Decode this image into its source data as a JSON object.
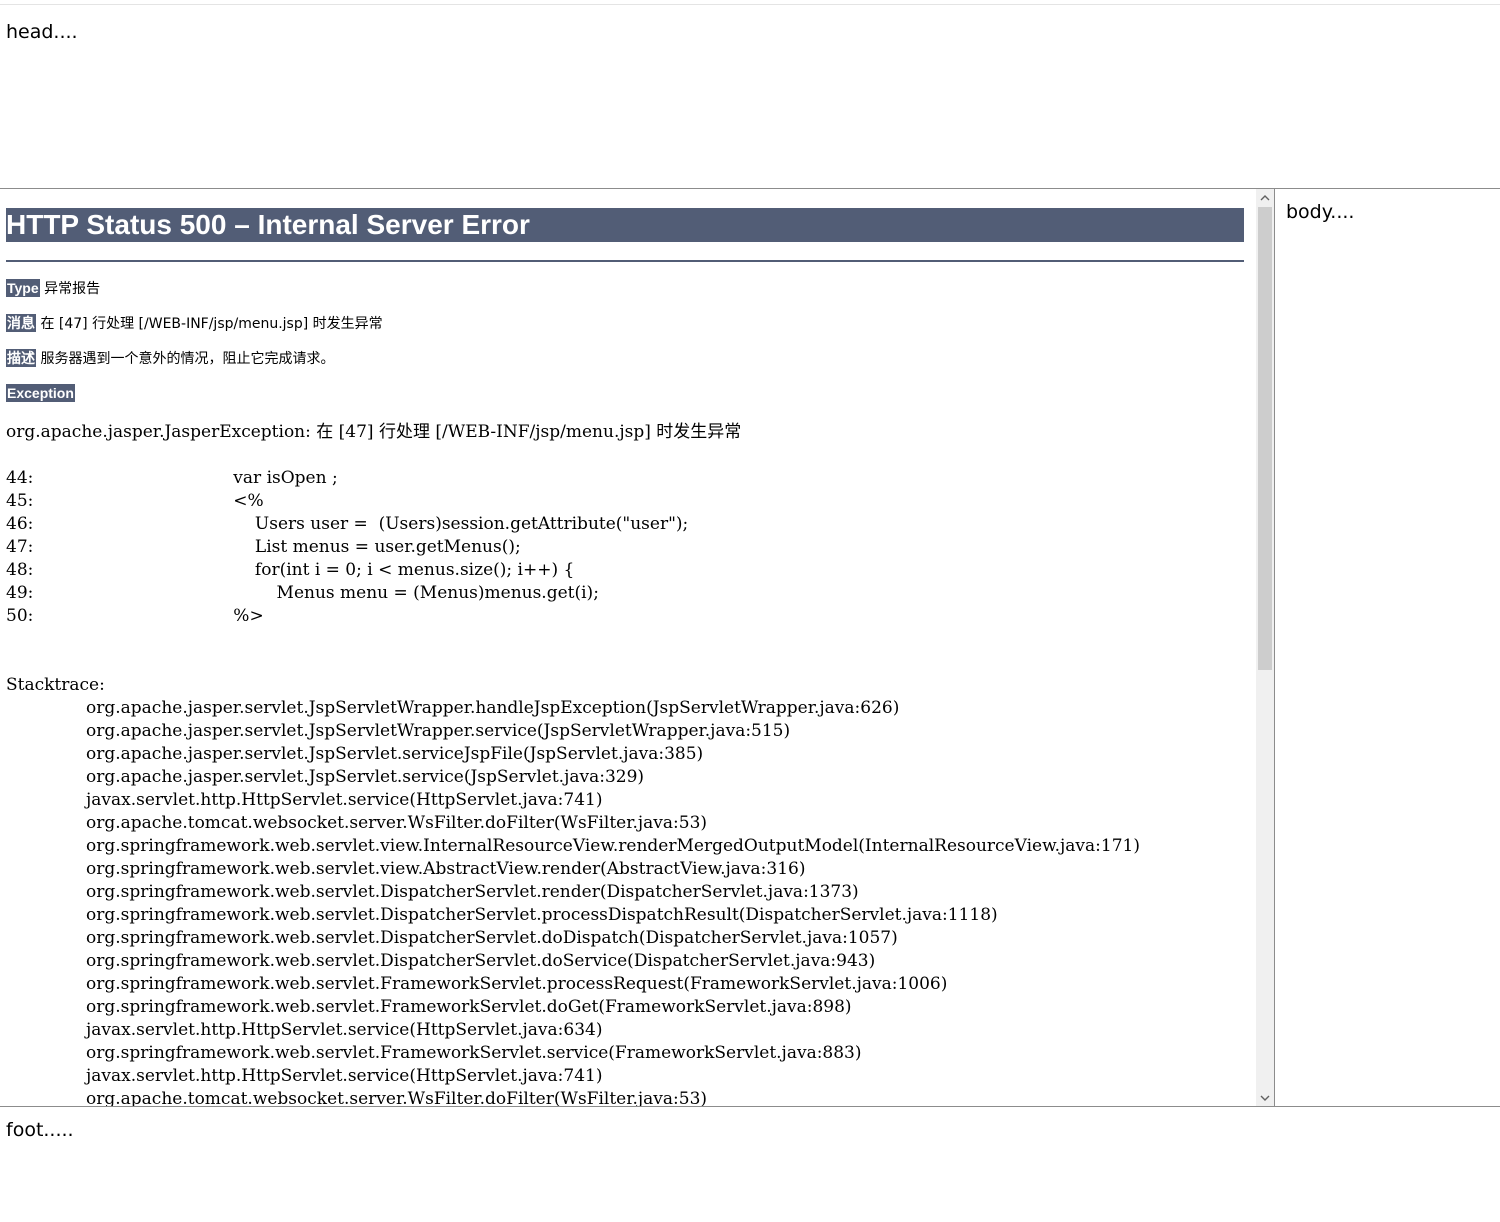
{
  "frames": {
    "head": "head....",
    "side": "body....",
    "foot": "foot....."
  },
  "error": {
    "title": "HTTP Status 500 – Internal Server Error",
    "type_label": "Type",
    "type_value": "异常报告",
    "message_label": "消息",
    "message_value": "在 [47] 行处理 [/WEB-INF/jsp/menu.jsp] 时发生异常",
    "description_label": "描述",
    "description_value": "服务器遇到一个意外的情况，阻止它完成请求。",
    "exception_label": "Exception",
    "exception_line": "org.apache.jasper.JasperException: 在 [47] 行处理 [/WEB-INF/jsp/menu.jsp] 时发生异常",
    "code_lines": [
      "44:                                     var isOpen ;",
      "45:                                     <%",
      "46:                                         Users user =  (Users)session.getAttribute(\"user\");",
      "47:                                         List menus = user.getMenus();",
      "48:                                         for(int i = 0; i < menus.size(); i++) {",
      "49:                                             Menus menu = (Menus)menus.get(i);",
      "50:                                     %>"
    ],
    "stacktrace_label": "Stacktrace:",
    "stacktrace": [
      "org.apache.jasper.servlet.JspServletWrapper.handleJspException(JspServletWrapper.java:626)",
      "org.apache.jasper.servlet.JspServletWrapper.service(JspServletWrapper.java:515)",
      "org.apache.jasper.servlet.JspServlet.serviceJspFile(JspServlet.java:385)",
      "org.apache.jasper.servlet.JspServlet.service(JspServlet.java:329)",
      "javax.servlet.http.HttpServlet.service(HttpServlet.java:741)",
      "org.apache.tomcat.websocket.server.WsFilter.doFilter(WsFilter.java:53)",
      "org.springframework.web.servlet.view.InternalResourceView.renderMergedOutputModel(InternalResourceView.java:171)",
      "org.springframework.web.servlet.view.AbstractView.render(AbstractView.java:316)",
      "org.springframework.web.servlet.DispatcherServlet.render(DispatcherServlet.java:1373)",
      "org.springframework.web.servlet.DispatcherServlet.processDispatchResult(DispatcherServlet.java:1118)",
      "org.springframework.web.servlet.DispatcherServlet.doDispatch(DispatcherServlet.java:1057)",
      "org.springframework.web.servlet.DispatcherServlet.doService(DispatcherServlet.java:943)",
      "org.springframework.web.servlet.FrameworkServlet.processRequest(FrameworkServlet.java:1006)",
      "org.springframework.web.servlet.FrameworkServlet.doGet(FrameworkServlet.java:898)",
      "javax.servlet.http.HttpServlet.service(HttpServlet.java:634)",
      "org.springframework.web.servlet.FrameworkServlet.service(FrameworkServlet.java:883)",
      "javax.servlet.http.HttpServlet.service(HttpServlet.java:741)",
      "org.apache.tomcat.websocket.server.WsFilter.doFilter(WsFilter.java:53)"
    ]
  },
  "scrollbar": {
    "up_icon": "chevron-up-icon",
    "down_icon": "chevron-down-icon"
  },
  "colors": {
    "accent": "#525d76",
    "scroll_track": "#f0f0f0",
    "scroll_thumb": "#cdcdcd",
    "frame_border": "#8c8c8c"
  }
}
